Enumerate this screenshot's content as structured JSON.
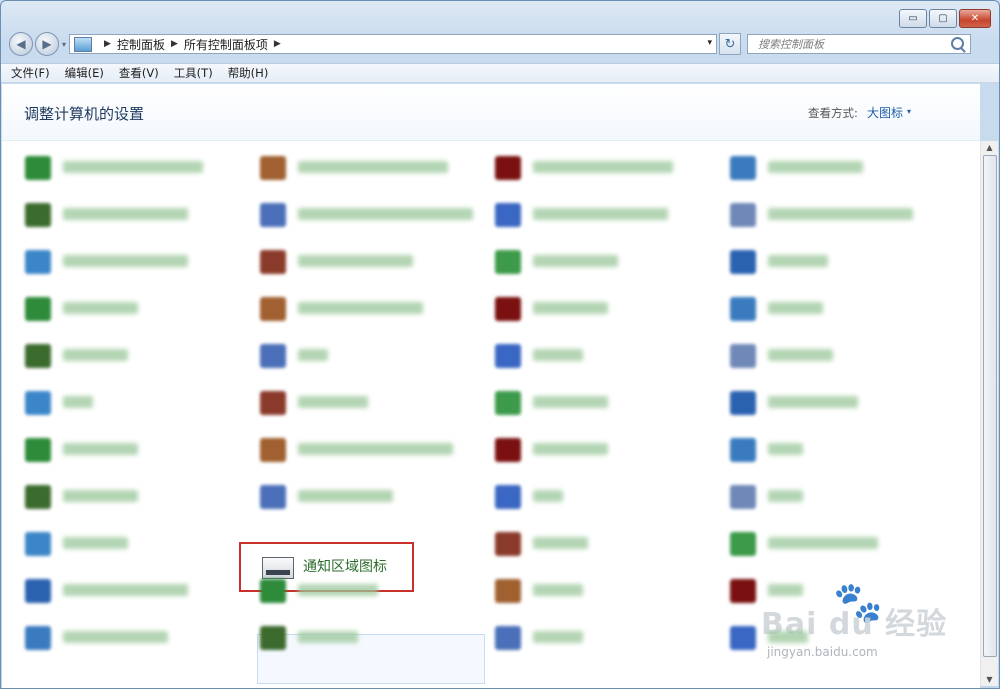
{
  "window": {
    "buttons": {
      "minimize": "▭",
      "maximize": "▢",
      "close": "✕"
    }
  },
  "nav": {
    "back": "◀",
    "forward": "▶",
    "dropdown": "▾",
    "breadcrumb": [
      "控制面板",
      "所有控制面板项"
    ],
    "refresh": "↻",
    "search_placeholder": "搜索控制面板"
  },
  "menu": [
    "文件(F)",
    "编辑(E)",
    "查看(V)",
    "工具(T)",
    "帮助(H)"
  ],
  "page": {
    "title": "调整计算机的设置",
    "view_label": "查看方式:",
    "view_value": "大图标",
    "view_caret": "▾"
  },
  "focused_item": {
    "label": "通知区域图标",
    "icon": "notification-area-icon"
  },
  "obscured_items": {
    "note_colors": [
      "#2d8b3a",
      "#a06030",
      "#7a1010",
      "#3a7bbf",
      "#3c6b2e",
      "#4b6fb8",
      "#3a67c4",
      "#7088b8",
      "#3b86c9",
      "#8a3a2a",
      "#3c9a4a",
      "#2a62b0"
    ]
  },
  "watermark": {
    "brand": "Bai  du 经验",
    "url": "jingyan.baidu.com"
  },
  "colors": {
    "accent": "#1f5da8",
    "highlight": "#c9302c",
    "link_green": "#2c6e2c"
  }
}
